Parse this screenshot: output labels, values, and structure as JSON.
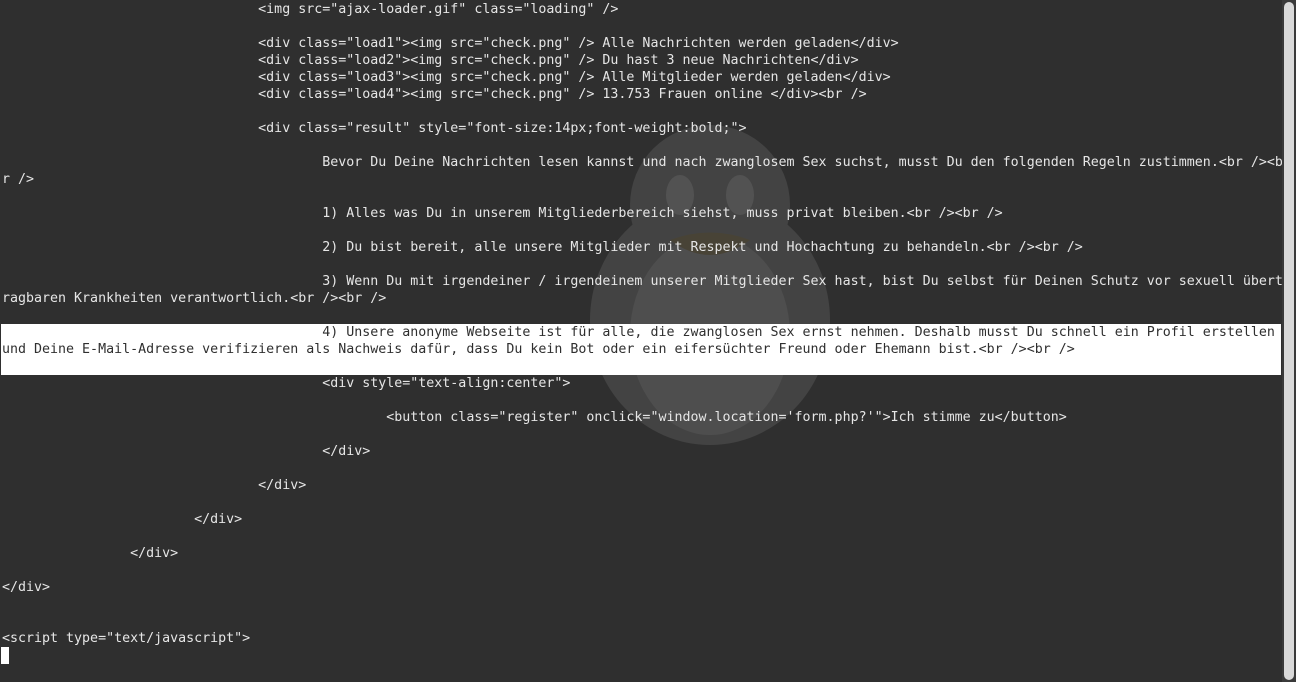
{
  "terminal": {
    "lines": [
      "                                <img src=\"ajax-loader.gif\" class=\"loading\" />",
      "                                <div class=\"load1\"><img src=\"check.png\" /> Alle Nachrichten werden geladen</div>",
      "                                <div class=\"load2\"><img src=\"check.png\" /> Du hast 3 neue Nachrichten</div>",
      "                                <div class=\"load3\"><img src=\"check.png\" /> Alle Mitglieder werden geladen</div>",
      "                                <div class=\"load4\"><img src=\"check.png\" /> 13.753 Frauen online </div><br />",
      "                                <div class=\"result\" style=\"font-size:14px;font-weight:bold;\">",
      "                                        Bevor Du Deine Nachrichten lesen kannst und nach zwanglosem Sex suchst, musst Du den folgenden Regeln zustimmen.<br /><b",
      "r />",
      "                                        1) Alles was Du in unserem Mitgliederbereich siehst, muss privat bleiben.<br /><br />",
      "                                        2) Du bist bereit, alle unsere Mitglieder mit Respekt und Hochachtung zu behandeln.<br /><br />",
      "                                        3) Wenn Du mit irgendeiner / irgendeinem unserer Mitglieder Sex hast, bist Du selbst für Deinen Schutz vor sexuell übert",
      "ragbaren Krankheiten verantwortlich.<br /><br />",
      "                                        4) Unsere anonyme Webseite ist für alle, die zwanglosen Sex ernst nehmen. Deshalb musst Du schnell ein Profil erstellen",
      "und Deine E-Mail-Adresse verifizieren als Nachweis dafür, dass Du kein Bot oder ein eifersüchter Freund oder Ehemann bist.<br /><br />",
      "                                        <div style=\"text-align:center\">",
      "                                                <button class=\"register\" onclick=\"window.location='form.php?'\">Ich stimme zu</button>",
      "                                        </div>",
      "                                </div>",
      "                        </div>",
      "                </div>",
      "</div>",
      "<script type=\"text/javascript\">"
    ]
  },
  "colors": {
    "background": "#2f2f2f",
    "text": "#e6e6e6",
    "highlight": "#ffffff"
  }
}
